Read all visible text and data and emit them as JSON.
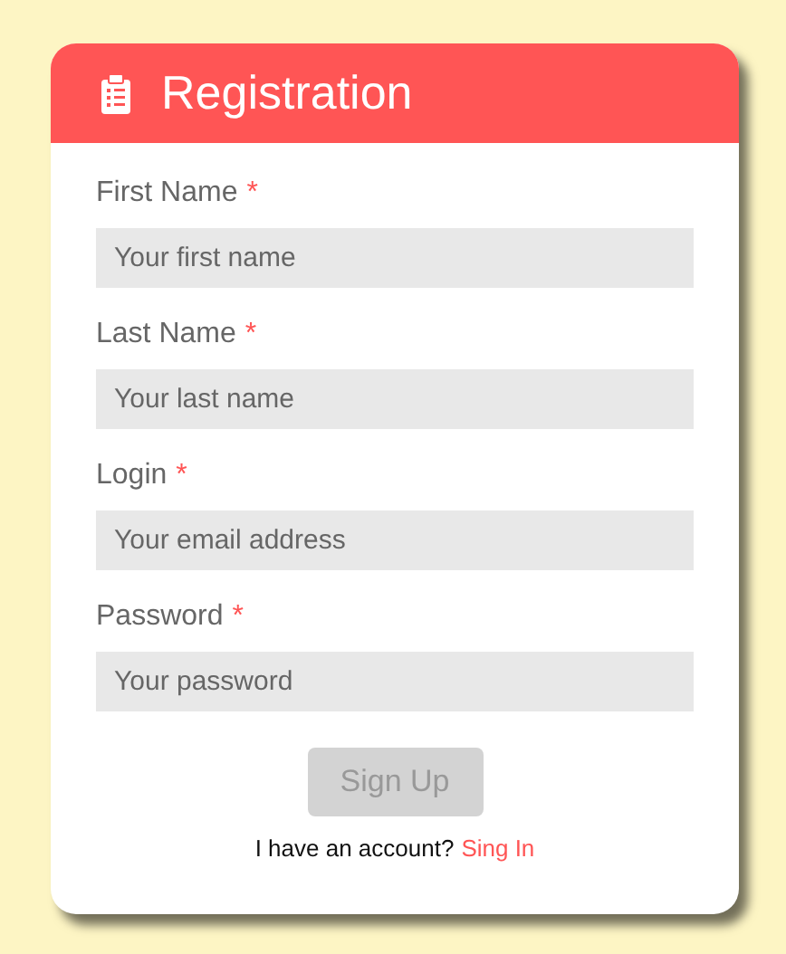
{
  "title": "Registration",
  "fields": [
    {
      "label": "First Name",
      "required": true,
      "placeholder": "Your first name"
    },
    {
      "label": "Last Name",
      "required": true,
      "placeholder": "Your last name"
    },
    {
      "label": "Login",
      "required": true,
      "placeholder": "Your email address"
    },
    {
      "label": "Password",
      "required": true,
      "placeholder": "Your password"
    }
  ],
  "submit": {
    "label": "Sign Up",
    "disabled": true
  },
  "footer": {
    "text": "I have an account?",
    "link": "Sing In"
  },
  "required_mark": "*"
}
